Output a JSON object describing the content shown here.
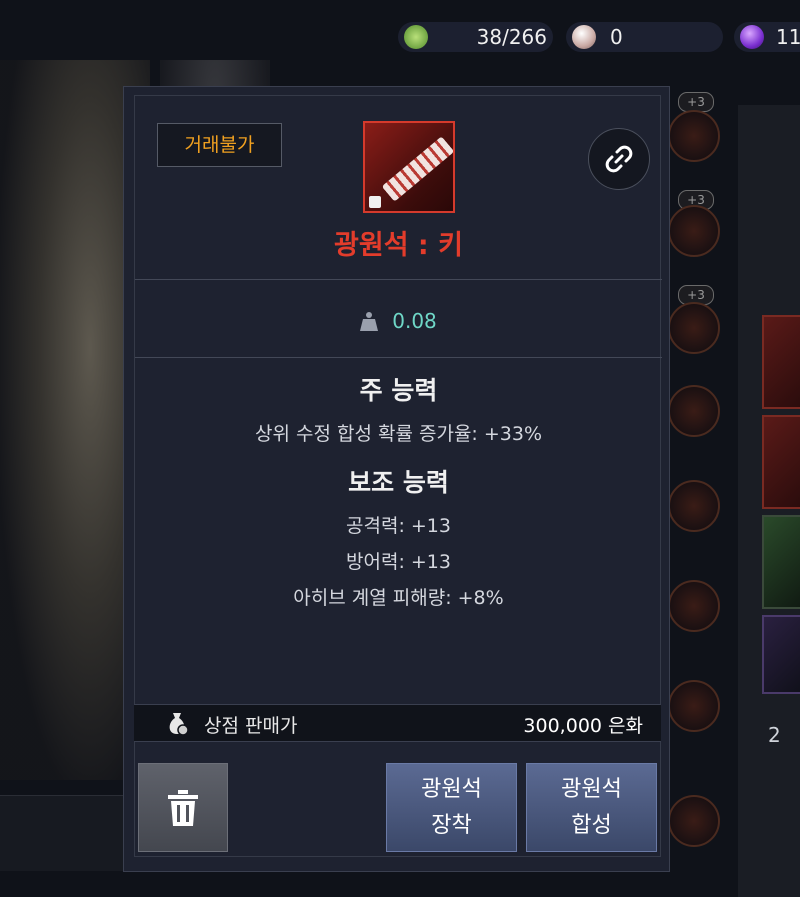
{
  "currency_bar": {
    "green_count": "38/266",
    "pearl_count": "0",
    "purple_count": "11"
  },
  "background": {
    "slot_plus_1": "+3",
    "slot_plus_2": "+3",
    "slot_plus_3": "+3",
    "right_panel_value": "2"
  },
  "item": {
    "trade_status": "거래불가",
    "name": "광원석 : 키",
    "weight": "0.08",
    "main_ability_title": "주 능력",
    "main_ability_stats": [
      "상위 수정 합성 확률 증가율: +33%"
    ],
    "sub_ability_title": "보조 능력",
    "sub_ability_stats": [
      "공격력: +13",
      "방어력: +13",
      "아히브 계열 피해량: +8%"
    ],
    "shop_price_label": "상점 판매가",
    "shop_price_value": "300,000 은화"
  },
  "actions": {
    "equip_line1": "광원석",
    "equip_line2": "장착",
    "combine_line1": "광원석",
    "combine_line2": "합성"
  },
  "colors": {
    "item_name": "#e33c2b",
    "trade_status": "#f0a020",
    "weight": "#6fd7c7",
    "action_button": "#4a5a82"
  },
  "icons": [
    "green-currency-icon",
    "pearl-icon",
    "purple-orb-icon",
    "link-icon",
    "weight-icon",
    "money-bag-icon",
    "trash-icon",
    "lock-icon"
  ]
}
